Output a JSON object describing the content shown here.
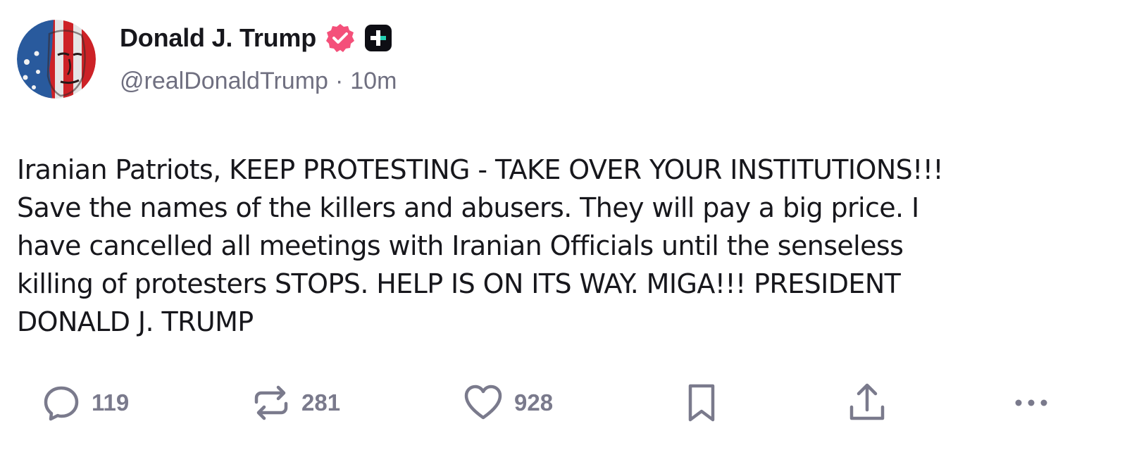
{
  "author": {
    "display_name": "Donald J. Trump",
    "handle": "@realDonaldTrump",
    "separator": "·",
    "time": "10m",
    "avatar": "flag-face-avatar",
    "verified_icon": "verified-badge-icon",
    "plus_icon": "plus-badge-icon"
  },
  "post": {
    "text": "Iranian Patriots, KEEP PROTESTING - TAKE OVER YOUR INSTITUTIONS!!!\nSave the names of the killers and abusers. They will pay a big price. I\nhave cancelled all meetings with Iranian Officials until the senseless\nkilling of protesters STOPS. HELP IS ON ITS WAY. MIGA!!! PRESIDENT\nDONALD J. TRUMP"
  },
  "actions": {
    "reply": {
      "icon": "reply-icon",
      "count": "119"
    },
    "repost": {
      "icon": "repost-icon",
      "count": "281"
    },
    "like": {
      "icon": "heart-icon",
      "count": "928"
    },
    "bookmark": {
      "icon": "bookmark-icon"
    },
    "share": {
      "icon": "share-icon"
    },
    "more": {
      "icon": "more-icon"
    }
  },
  "colors": {
    "text": "#17171c",
    "muted": "#6f6f80",
    "icon": "#7a7a8c",
    "verified": "#f4507a",
    "plus": "#0e0e14"
  }
}
